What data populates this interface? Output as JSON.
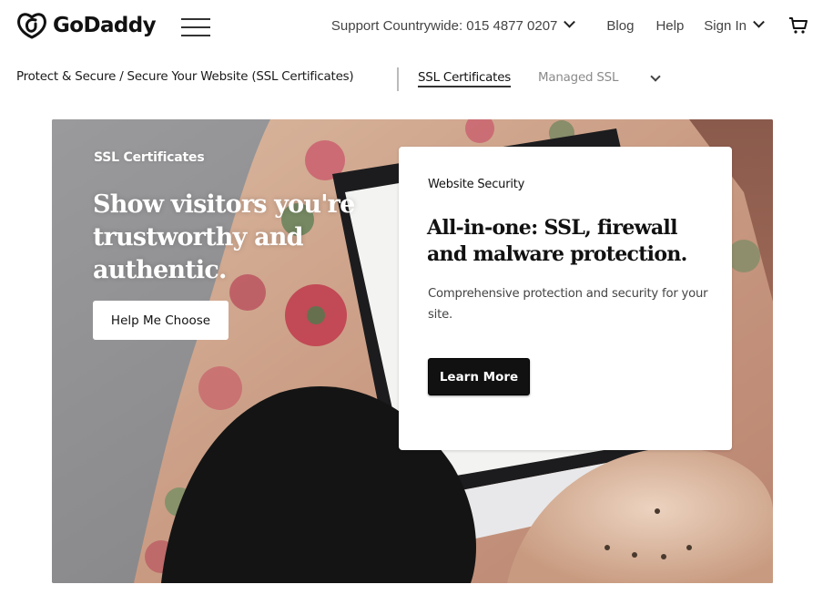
{
  "header": {
    "brand": "GoDaddy",
    "menu_icon": "hamburger-menu-icon",
    "support_label": "Support Countrywide: 015 4877 0207",
    "blog_label": "Blog",
    "help_label": "Help",
    "signin_label": "Sign In",
    "cart_icon": "cart-icon"
  },
  "subnav": {
    "breadcrumb": "Protect & Secure / Secure Your Website (SSL Certificates)",
    "tabs": [
      {
        "label": "SSL Certificates",
        "active": true
      },
      {
        "label": "Managed SSL",
        "active": false
      }
    ],
    "more_icon": "chevron-down-icon"
  },
  "hero": {
    "eyebrow": "SSL Certificates",
    "title": "Show visitors you're trustworthy and authentic.",
    "button_label": "Help Me Choose"
  },
  "card": {
    "eyebrow": "Website Security",
    "title": "All-in-one: SSL, firewall and malware protection.",
    "description": "Comprehensive protection and security for your site.",
    "button_label": "Learn More"
  },
  "colors": {
    "brand_text": "#111111",
    "primary_button": "#111111",
    "muted_text": "#8a8a8a"
  }
}
